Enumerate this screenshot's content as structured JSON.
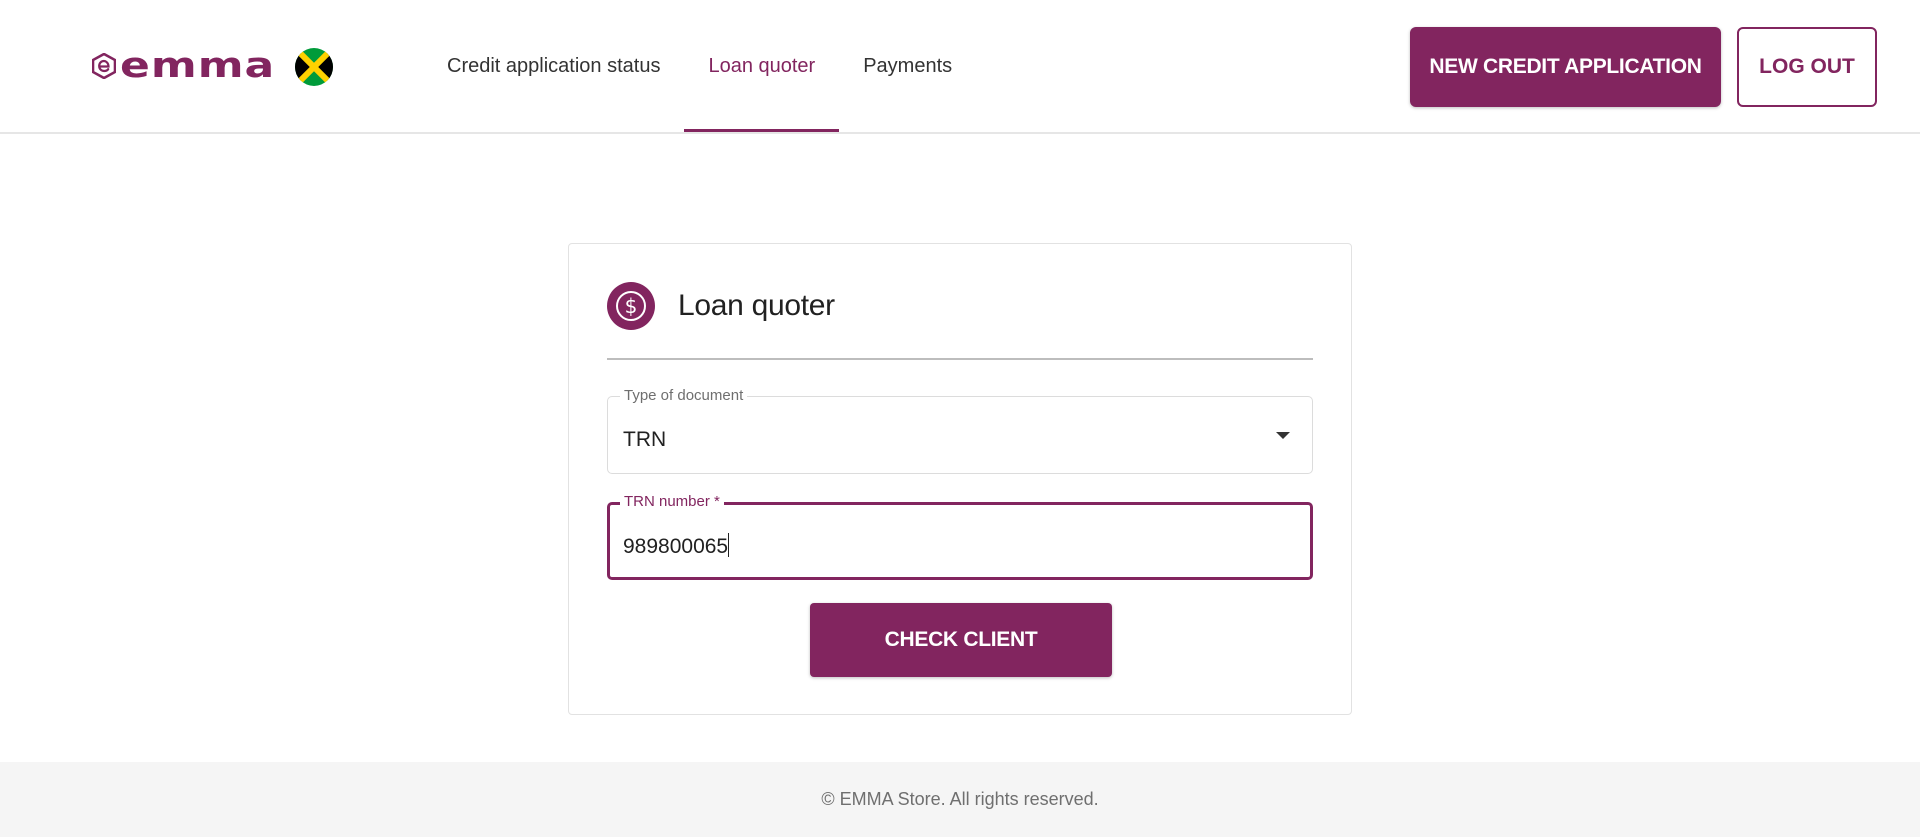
{
  "brand": {
    "logo_text": "emma",
    "logo_icon": "emma-e-icon",
    "flag_icon": "jamaica-flag-icon",
    "accent_color": "#82255f"
  },
  "nav": {
    "items": [
      {
        "label": "Credit application status",
        "active": false
      },
      {
        "label": "Loan quoter",
        "active": true
      },
      {
        "label": "Payments",
        "active": false
      }
    ]
  },
  "header": {
    "new_application_label": "NEW CREDIT APPLICATION",
    "logout_label": "LOG OUT"
  },
  "card": {
    "icon": "dollar-icon",
    "icon_glyph": "$",
    "title": "Loan quoter",
    "document_type": {
      "label": "Type of document",
      "value": "TRN"
    },
    "trn_number": {
      "label": "TRN number",
      "required_mark": "*",
      "value": "989800065"
    },
    "check_client_label": "CHECK CLIENT"
  },
  "footer": {
    "text": "© EMMA Store. All rights reserved."
  }
}
